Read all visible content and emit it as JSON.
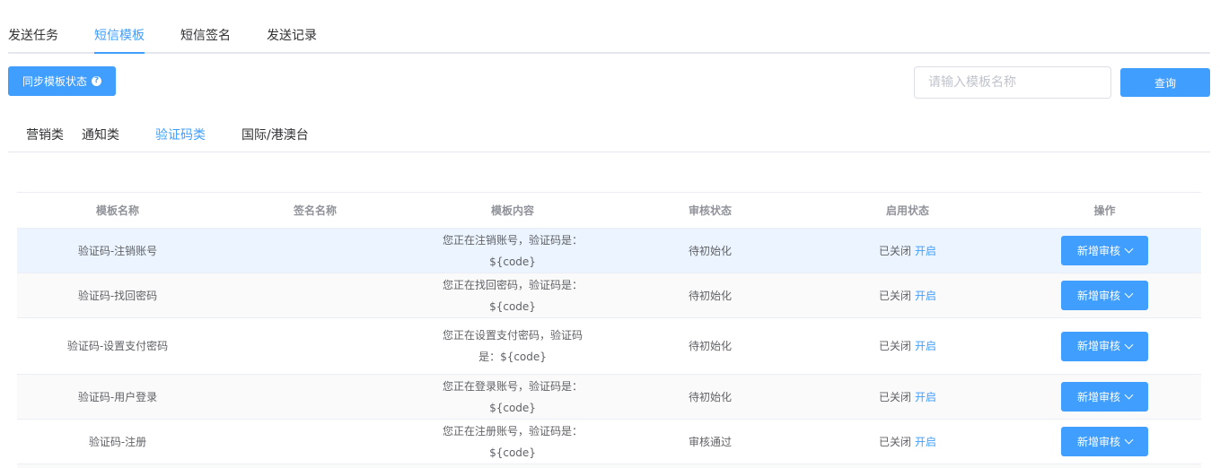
{
  "top_tabs": [
    "发送任务",
    "短信模板",
    "短信签名",
    "发送记录"
  ],
  "active_top_tab": "短信模板",
  "toolbar": {
    "sync_label": "同步模板状态",
    "search_placeholder": "请输入模板名称",
    "query_label": "查询"
  },
  "sub_tabs": [
    "营销类",
    "通知类",
    "验证码类",
    "国际/港澳台"
  ],
  "active_sub_tab": "验证码类",
  "table": {
    "columns": [
      "模板名称",
      "签名名称",
      "模板内容",
      "审核状态",
      "启用状态",
      "操作"
    ],
    "rows": [
      {
        "name": "验证码-注销账号",
        "signature": "",
        "content": "您正在注销账号，验证码是：${code}",
        "audit": "待初始化",
        "enabled": "已关闭",
        "toggle": "开启",
        "action": "新增审核"
      },
      {
        "name": "验证码-找回密码",
        "signature": "",
        "content": "您正在找回密码，验证码是：${code}",
        "audit": "待初始化",
        "enabled": "已关闭",
        "toggle": "开启",
        "action": "新增审核"
      },
      {
        "name": "验证码-设置支付密码",
        "signature": "",
        "content": "您正在设置支付密码，验证码是：${code}",
        "audit": "待初始化",
        "enabled": "已关闭",
        "toggle": "开启",
        "action": "新增审核"
      },
      {
        "name": "验证码-用户登录",
        "signature": "",
        "content": "您正在登录账号，验证码是：${code}",
        "audit": "待初始化",
        "enabled": "已关闭",
        "toggle": "开启",
        "action": "新增审核"
      },
      {
        "name": "验证码-注册",
        "signature": "",
        "content": "您正在注册账号，验证码是：${code}",
        "audit": "审核通过",
        "enabled": "已关闭",
        "toggle": "开启",
        "action": "新增审核"
      }
    ]
  },
  "colors": {
    "primary": "#409eff",
    "hover_row": "#ecf5ff",
    "stripe_row": "#fafafa"
  }
}
